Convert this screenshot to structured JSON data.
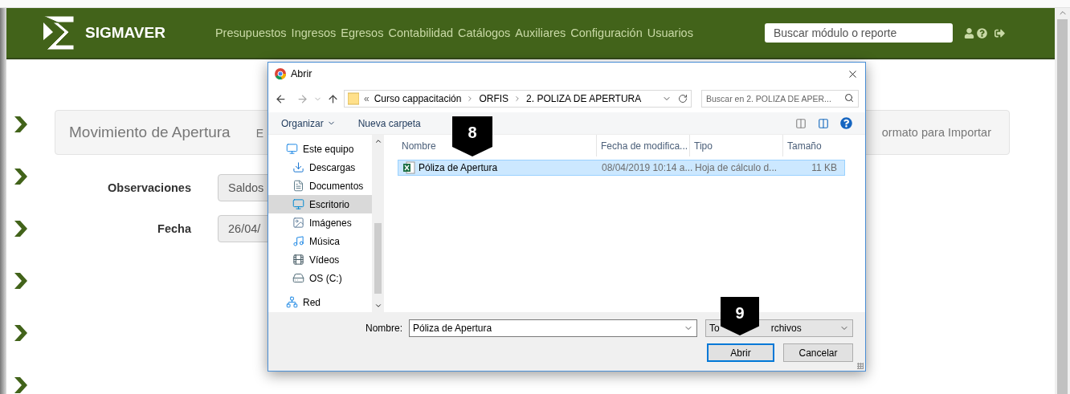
{
  "header": {
    "brand": "SIGMAVER",
    "nav": [
      "Presupuestos",
      "Ingresos",
      "Egresos",
      "Contabilidad",
      "Catálogos",
      "Auxiliares",
      "Configuración",
      "Usuarios"
    ],
    "search": {
      "placeholder": "Buscar módulo o reporte"
    }
  },
  "page": {
    "panel_title": "Movimiento de Apertura",
    "panel_tab_cut": "E",
    "panel_action": "ormato para Importar",
    "fields": [
      {
        "label": "Observaciones",
        "value": "Saldos"
      },
      {
        "label": "Fecha",
        "value": "26/04/"
      }
    ]
  },
  "dialog": {
    "title": "Abrir",
    "breadcrumb": {
      "overflow_mark": "«",
      "crumbs": [
        "Curso cappacitación",
        "ORFIS",
        "2. POLIZA DE APERTURA"
      ]
    },
    "search": {
      "placeholder": "Buscar en 2. POLIZA DE APER..."
    },
    "toolbar": {
      "organize": "Organizar",
      "new_folder": "Nueva carpeta"
    },
    "nav": [
      {
        "label": "Este equipo",
        "kind": "computer",
        "selected": false,
        "children": [
          {
            "label": "Descargas",
            "kind": "downloads",
            "selected": false
          },
          {
            "label": "Documentos",
            "kind": "documents",
            "selected": false
          },
          {
            "label": "Escritorio",
            "kind": "desktop",
            "selected": true
          },
          {
            "label": "Imágenes",
            "kind": "images",
            "selected": false
          },
          {
            "label": "Música",
            "kind": "music",
            "selected": false
          },
          {
            "label": "Vídeos",
            "kind": "videos",
            "selected": false
          },
          {
            "label": "OS (C:)",
            "kind": "drive",
            "selected": false
          }
        ]
      },
      {
        "label": "Red",
        "kind": "network",
        "selected": false
      }
    ],
    "columns": [
      "Nombre",
      "Fecha de modifica...",
      "Tipo",
      "Tamaño"
    ],
    "files": [
      {
        "cells": [
          "Póliza de Apertura",
          "08/04/2019 10:14 a...",
          "Hoja de cálculo d...",
          "11 KB"
        ],
        "selected": true
      }
    ],
    "filename_label": "Nombre:",
    "filename": "Póliza de Apertura",
    "filter_visible": [
      "To",
      "rchivos"
    ],
    "buttons": [
      {
        "label": "Abrir",
        "default": true
      },
      {
        "label": "Cancelar",
        "default": false
      }
    ]
  },
  "badges": [
    {
      "label": "8"
    },
    {
      "label": "9"
    }
  ]
}
